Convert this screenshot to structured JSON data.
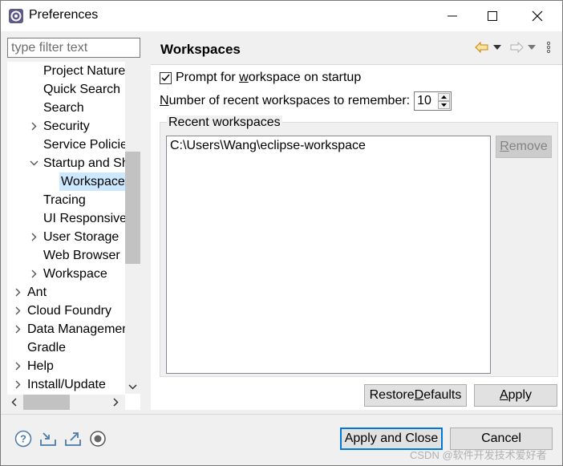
{
  "window": {
    "title": "Preferences",
    "controls": {
      "minimize": "minimize",
      "maximize": "maximize",
      "close": "close"
    }
  },
  "sidebar": {
    "filter_placeholder": "type filter text",
    "tree": [
      {
        "label": "Project Natures",
        "expandable": false
      },
      {
        "label": "Quick Search",
        "expandable": false
      },
      {
        "label": "Search",
        "expandable": false
      },
      {
        "label": "Security",
        "expandable": true,
        "expanded": false
      },
      {
        "label": "Service Policies",
        "expandable": false
      },
      {
        "label": "Startup and Shutdown",
        "expandable": true,
        "expanded": true
      },
      {
        "label": "Workspaces",
        "expandable": false,
        "selected": true
      },
      {
        "label": "Tracing",
        "expandable": false
      },
      {
        "label": "UI Responsiveness",
        "expandable": false
      },
      {
        "label": "User Storage",
        "expandable": true,
        "expanded": false
      },
      {
        "label": "Web Browser",
        "expandable": false
      },
      {
        "label": "Workspace",
        "expandable": true,
        "expanded": false
      },
      {
        "label": "Ant",
        "expandable": true,
        "expanded": false
      },
      {
        "label": "Cloud Foundry",
        "expandable": true,
        "expanded": false
      },
      {
        "label": "Data Management",
        "expandable": true,
        "expanded": false
      },
      {
        "label": "Gradle",
        "expandable": false
      },
      {
        "label": "Help",
        "expandable": true,
        "expanded": false
      },
      {
        "label": "Install/Update",
        "expandable": true,
        "expanded": false
      }
    ]
  },
  "page": {
    "title": "Workspaces",
    "prompt_checkbox": {
      "label_before": "Prompt for ",
      "accel": "w",
      "label_after": "orkspace on startup",
      "checked": true
    },
    "recent_count": {
      "accel": "N",
      "label_after": "umber of recent workspaces to remember:",
      "value": "10"
    },
    "recent_group_label": "Recent workspaces",
    "recent_items": [
      "C:\\Users\\Wang\\eclipse-workspace"
    ],
    "remove": {
      "accel": "R",
      "rest": "emove"
    }
  },
  "buttons": {
    "restore_defaults": {
      "before": "Restore ",
      "accel": "D",
      "after": "efaults"
    },
    "apply": {
      "accel": "A",
      "after": "pply"
    },
    "apply_and_close": "Apply and Close",
    "cancel": "Cancel"
  },
  "bottom_icons": [
    "help-icon",
    "import-icon",
    "export-icon",
    "record-icon"
  ],
  "watermark": "CSDN @软件开发技术爱好者",
  "colors": {
    "selection": "#cce8ff",
    "default_button_border": "#0078d7",
    "arrow_accent": "#e8a317"
  }
}
